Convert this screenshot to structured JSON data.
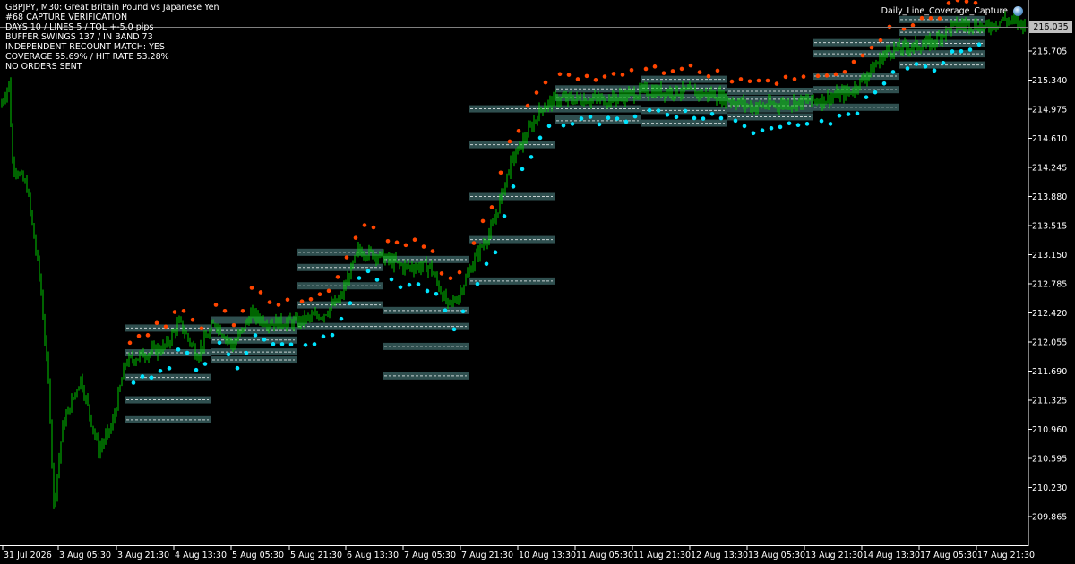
{
  "symbol_header": "GBPJPY, M30:  Great Britain Pound vs Japanese Yen",
  "info_lines": [
    "#68 CAPTURE VERIFICATION",
    "DAYS 10 / LINES 5 / TOL +-5.0 pips",
    "BUFFER SWINGS 137 / IN BAND 73",
    "INDEPENDENT RECOUNT MATCH: YES",
    "COVERAGE 55.69% / HIT RATE 53.28%",
    "NO ORDERS SENT"
  ],
  "ea_name": "Daily_Line_Coverage_Capture",
  "current_price": "216.035",
  "colors": {
    "background": "#000000",
    "candles": "#00c800",
    "band_fill": "#2f4f4f",
    "band_line": "#c8d2d2",
    "swing_high": "#ff4500",
    "swing_low": "#00e5ff",
    "axis": "#ffffff",
    "current_price_box": "#c0c0c0"
  },
  "chart_data": {
    "type": "candlestick",
    "price_axis": {
      "ylim": [
        209.53,
        216.25
      ],
      "ticks": [
        "216.035",
        "215.705",
        "215.340",
        "214.975",
        "214.610",
        "214.245",
        "213.880",
        "213.515",
        "213.150",
        "212.785",
        "212.420",
        "212.055",
        "211.690",
        "211.325",
        "210.960",
        "210.595",
        "210.230",
        "209.865"
      ]
    },
    "time_axis": {
      "ticks": [
        "31 Jul 2026",
        "3 Aug 05:30",
        "3 Aug 21:30",
        "4 Aug 13:30",
        "5 Aug 05:30",
        "5 Aug 21:30",
        "6 Aug 13:30",
        "7 Aug 05:30",
        "7 Aug 21:30",
        "10 Aug 13:30",
        "11 Aug 05:30",
        "11 Aug 21:30",
        "12 Aug 13:30",
        "13 Aug 05:30",
        "13 Aug 21:30",
        "14 Aug 13:30",
        "17 Aug 05:30",
        "17 Aug 21:30"
      ]
    },
    "daily_lines": [
      {
        "day": 0,
        "levels": [
          212.23,
          211.92,
          211.61,
          211.33,
          211.08
        ]
      },
      {
        "day": 1,
        "levels": [
          212.33,
          212.2,
          212.08,
          211.93,
          211.83
        ]
      },
      {
        "day": 2,
        "levels": [
          213.18,
          212.99,
          212.76,
          212.52,
          212.25
        ]
      },
      {
        "day": 3,
        "levels": [
          212.45,
          212.25,
          212.0,
          211.63,
          213.09
        ]
      },
      {
        "day": 4,
        "levels": [
          214.98,
          214.53,
          213.88,
          213.34,
          212.82
        ]
      },
      {
        "day": 5,
        "levels": [
          215.23,
          215.12,
          214.98,
          214.86,
          214.83
        ]
      },
      {
        "day": 6,
        "levels": [
          215.35,
          215.24,
          215.12,
          214.96,
          214.8
        ]
      },
      {
        "day": 7,
        "levels": [
          215.2,
          215.1,
          214.98,
          214.88,
          215.02
        ]
      },
      {
        "day": 8,
        "levels": [
          215.81,
          215.67,
          215.39,
          215.22,
          215.0
        ]
      },
      {
        "day": 9,
        "levels": [
          216.1,
          215.94,
          215.8,
          215.67,
          215.53
        ]
      }
    ],
    "swing_highs_sample": [
      [
        211.98,
        212.58
      ],
      [
        212.65,
        212.54
      ],
      [
        213.45,
        213.05
      ],
      [
        212.5,
        211.28
      ],
      [
        214.08,
        214.48
      ],
      [
        215.42,
        215.47
      ],
      [
        215.38,
        214.4
      ],
      [
        215.46,
        215.42
      ],
      [
        215.6,
        215.02
      ],
      [
        216.1,
        215.33
      ]
    ],
    "swing_lows_sample": [
      [
        211.8,
        211.65
      ],
      [
        211.95,
        211.98
      ],
      [
        212.09,
        212.16
      ],
      [
        212.9,
        212.76
      ],
      [
        213.78,
        214.91
      ],
      [
        215.36,
        214.73
      ],
      [
        214.78,
        215.33
      ],
      [
        214.7,
        214.82
      ],
      [
        215.86,
        215.62
      ],
      [
        215.73,
        215.89
      ]
    ]
  }
}
